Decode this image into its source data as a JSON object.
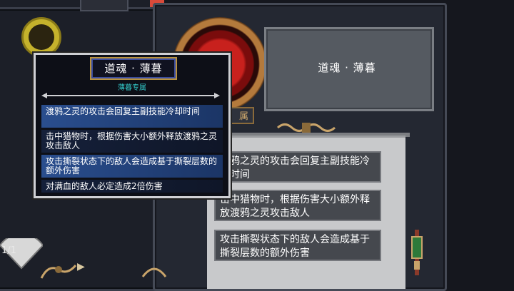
{
  "header": {
    "title": "道魂 · 薄暮"
  },
  "tag": {
    "label": "属"
  },
  "effects": [
    {
      "text": "渡鸦之灵的攻击会回复主副技能冷却时间"
    },
    {
      "text": "击中猎物时，根据伤害大小额外释放渡鸦之灵攻击敌人"
    },
    {
      "text": "攻击撕裂状态下的敌人会造成基于撕裂层数的额外伤害"
    }
  ],
  "tooltip": {
    "title": "道魂 · 薄暮",
    "subtitle": "薄暮专属",
    "rows": [
      {
        "text": "渡鸦之灵的攻击会回复主副技能冷却时间"
      },
      {
        "text": "击中猎物时，根据伤害大小额外释放渡鸦之灵攻击敌人"
      },
      {
        "text": "攻击撕裂状态下的敌人会造成基于撕裂层数的额外伤害"
      },
      {
        "text": "对满血的敌人必定造成2倍伤害"
      }
    ]
  },
  "fan": {
    "count": "1/1"
  },
  "colors": {
    "accent_gold": "#c9a46a",
    "tooltip_cyan": "#32c6c6",
    "row_blue": "#2a4e8e"
  }
}
